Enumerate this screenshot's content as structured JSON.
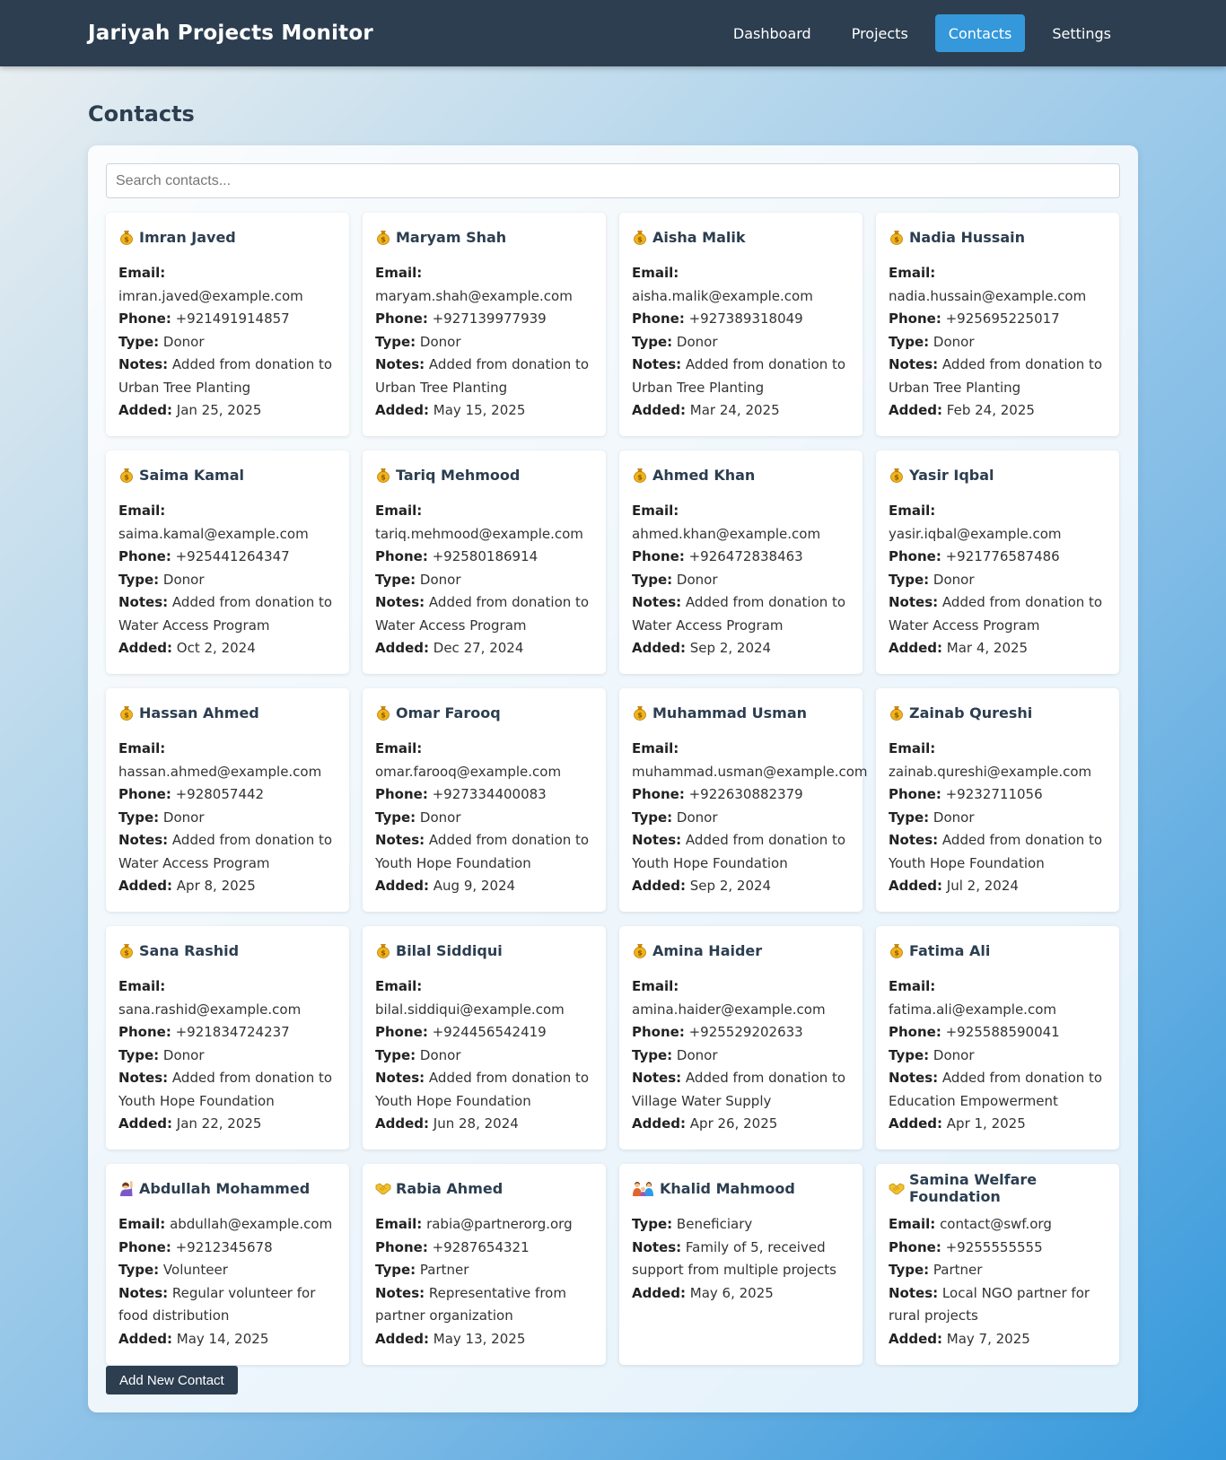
{
  "app": {
    "title": "Jariyah Projects Monitor"
  },
  "nav": [
    {
      "label": "Dashboard",
      "active": false
    },
    {
      "label": "Projects",
      "active": false
    },
    {
      "label": "Contacts",
      "active": true
    },
    {
      "label": "Settings",
      "active": false
    }
  ],
  "page": {
    "title": "Contacts"
  },
  "search": {
    "placeholder": "Search contacts...",
    "value": ""
  },
  "labels": {
    "email": "Email:",
    "phone": "Phone:",
    "type": "Type:",
    "notes": "Notes:",
    "added": "Added:"
  },
  "contacts": [
    {
      "icon": "money-bag-icon",
      "name": "Imran Javed",
      "email": "imran.javed@example.com",
      "phone": "+921491914857",
      "type": "Donor",
      "notes": "Added from donation to Urban Tree Planting",
      "added": "Jan 25, 2025"
    },
    {
      "icon": "money-bag-icon",
      "name": "Maryam Shah",
      "email": "maryam.shah@example.com",
      "phone": "+927139977939",
      "type": "Donor",
      "notes": "Added from donation to Urban Tree Planting",
      "added": "May 15, 2025"
    },
    {
      "icon": "money-bag-icon",
      "name": "Aisha Malik",
      "email": "aisha.malik@example.com",
      "phone": "+927389318049",
      "type": "Donor",
      "notes": "Added from donation to Urban Tree Planting",
      "added": "Mar 24, 2025"
    },
    {
      "icon": "money-bag-icon",
      "name": "Nadia Hussain",
      "email": "nadia.hussain@example.com",
      "phone": "+925695225017",
      "type": "Donor",
      "notes": "Added from donation to Urban Tree Planting",
      "added": "Feb 24, 2025"
    },
    {
      "icon": "money-bag-icon",
      "name": "Saima Kamal",
      "email": "saima.kamal@example.com",
      "phone": "+925441264347",
      "type": "Donor",
      "notes": "Added from donation to Water Access Program",
      "added": "Oct 2, 2024"
    },
    {
      "icon": "money-bag-icon",
      "name": "Tariq Mehmood",
      "email": "tariq.mehmood@example.com",
      "phone": "+92580186914",
      "type": "Donor",
      "notes": "Added from donation to Water Access Program",
      "added": "Dec 27, 2024"
    },
    {
      "icon": "money-bag-icon",
      "name": "Ahmed Khan",
      "email": "ahmed.khan@example.com",
      "phone": "+926472838463",
      "type": "Donor",
      "notes": "Added from donation to Water Access Program",
      "added": "Sep 2, 2024"
    },
    {
      "icon": "money-bag-icon",
      "name": "Yasir Iqbal",
      "email": "yasir.iqbal@example.com",
      "phone": "+921776587486",
      "type": "Donor",
      "notes": "Added from donation to Water Access Program",
      "added": "Mar 4, 2025"
    },
    {
      "icon": "money-bag-icon",
      "name": "Hassan Ahmed",
      "email": "hassan.ahmed@example.com",
      "phone": "+928057442",
      "type": "Donor",
      "notes": "Added from donation to Water Access Program",
      "added": "Apr 8, 2025"
    },
    {
      "icon": "money-bag-icon",
      "name": "Omar Farooq",
      "email": "omar.farooq@example.com",
      "phone": "+927334400083",
      "type": "Donor",
      "notes": "Added from donation to Youth Hope Foundation",
      "added": "Aug 9, 2024"
    },
    {
      "icon": "money-bag-icon",
      "name": "Muhammad Usman",
      "email": "muhammad.usman@example.com",
      "phone": "+922630882379",
      "type": "Donor",
      "notes": "Added from donation to Youth Hope Foundation",
      "added": "Sep 2, 2024"
    },
    {
      "icon": "money-bag-icon",
      "name": "Zainab Qureshi",
      "email": "zainab.qureshi@example.com",
      "phone": "+9232711056",
      "type": "Donor",
      "notes": "Added from donation to Youth Hope Foundation",
      "added": "Jul 2, 2024"
    },
    {
      "icon": "money-bag-icon",
      "name": "Sana Rashid",
      "email": "sana.rashid@example.com",
      "phone": "+921834724237",
      "type": "Donor",
      "notes": "Added from donation to Youth Hope Foundation",
      "added": "Jan 22, 2025"
    },
    {
      "icon": "money-bag-icon",
      "name": "Bilal Siddiqui",
      "email": "bilal.siddiqui@example.com",
      "phone": "+924456542419",
      "type": "Donor",
      "notes": "Added from donation to Youth Hope Foundation",
      "added": "Jun 28, 2024"
    },
    {
      "icon": "money-bag-icon",
      "name": "Amina Haider",
      "email": "amina.haider@example.com",
      "phone": "+925529202633",
      "type": "Donor",
      "notes": "Added from donation to Village Water Supply",
      "added": "Apr 26, 2025"
    },
    {
      "icon": "money-bag-icon",
      "name": "Fatima Ali",
      "email": "fatima.ali@example.com",
      "phone": "+925588590041",
      "type": "Donor",
      "notes": "Added from donation to Education Empowerment",
      "added": "Apr 1, 2025"
    },
    {
      "icon": "raising-hand-icon",
      "name": "Abdullah Mohammed",
      "email": "abdullah@example.com",
      "phone": "+9212345678",
      "type": "Volunteer",
      "notes": "Regular volunteer for food distribution",
      "added": "May 14, 2025"
    },
    {
      "icon": "handshake-icon",
      "name": "Rabia Ahmed",
      "email": "rabia@partnerorg.org",
      "phone": "+9287654321",
      "type": "Partner",
      "notes": "Representative from partner organization",
      "added": "May 13, 2025"
    },
    {
      "icon": "family-icon",
      "name": "Khalid Mahmood",
      "email": null,
      "phone": null,
      "type": "Beneficiary",
      "notes": "Family of 5, received support from multiple projects",
      "added": "May 6, 2025"
    },
    {
      "icon": "handshake-icon",
      "name": "Samina Welfare Foundation",
      "email": "contact@swf.org",
      "phone": "+9255555555",
      "type": "Partner",
      "notes": "Local NGO partner for rural projects",
      "added": "May 7, 2025"
    }
  ],
  "actions": {
    "add_contact_label": "Add New Contact"
  },
  "colors": {
    "nav_bg": "#2c3e50",
    "accent": "#3498db",
    "button_bg": "#2c3e50"
  }
}
